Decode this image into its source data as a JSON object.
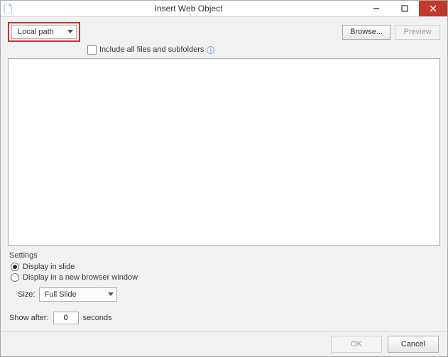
{
  "window": {
    "title": "Insert Web Object"
  },
  "path_type": {
    "selected": "Local path"
  },
  "buttons": {
    "browse": "Browse...",
    "preview": "Preview",
    "ok": "OK",
    "cancel": "Cancel"
  },
  "include": {
    "label": "Include all files and subfolders"
  },
  "settings": {
    "heading": "Settings",
    "display_in_slide": "Display in slide",
    "display_new_window": "Display in a new browser window",
    "size_label": "Size:",
    "size_value": "Full Slide",
    "show_after_label": "Show after:",
    "show_after_value": "0",
    "show_after_unit": "seconds"
  }
}
